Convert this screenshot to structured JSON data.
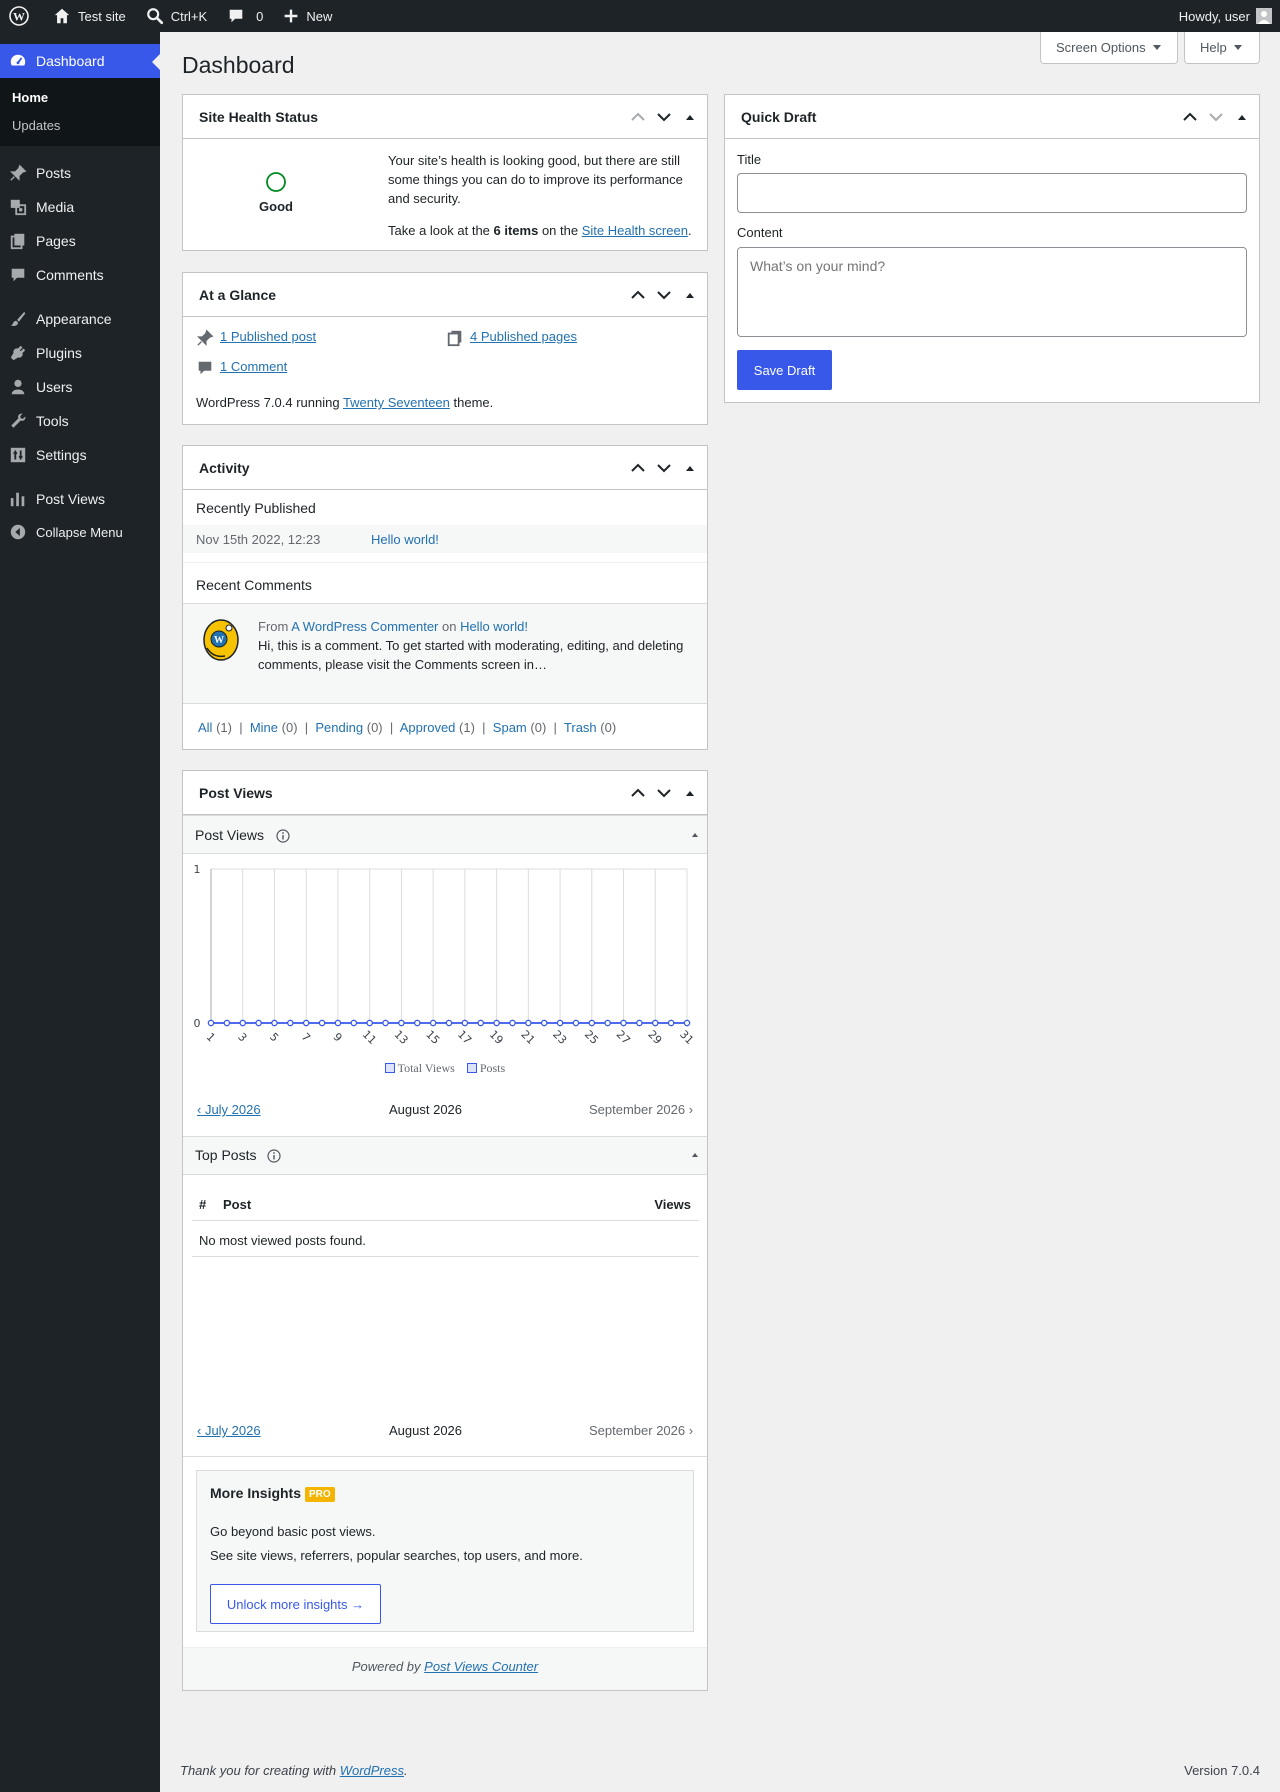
{
  "adminbar": {
    "site_name": "Test site",
    "search_shortcut": "Ctrl+K",
    "comments_count": "0",
    "new_label": "New",
    "howdy": "Howdy, user"
  },
  "sidebar": {
    "dashboard": "Dashboard",
    "submenu": {
      "home": "Home",
      "updates": "Updates"
    },
    "items": [
      {
        "label": "Posts",
        "icon": "pin-icon"
      },
      {
        "label": "Media",
        "icon": "media-icon"
      },
      {
        "label": "Pages",
        "icon": "pages-icon"
      },
      {
        "label": "Comments",
        "icon": "comment-icon"
      },
      {
        "label": "Appearance",
        "icon": "brush-icon"
      },
      {
        "label": "Plugins",
        "icon": "plugin-icon"
      },
      {
        "label": "Users",
        "icon": "user-icon"
      },
      {
        "label": "Tools",
        "icon": "wrench-icon"
      },
      {
        "label": "Settings",
        "icon": "settings-icon"
      },
      {
        "label": "Post Views",
        "icon": "chart-icon"
      }
    ],
    "collapse": "Collapse Menu"
  },
  "header": {
    "title": "Dashboard",
    "screen_options": "Screen Options",
    "help": "Help"
  },
  "site_health": {
    "title": "Site Health Status",
    "status": "Good",
    "message": "Your site’s health is looking good, but there are still some things you can do to improve its performance and security.",
    "take_look_pre": "Take a look at the ",
    "items": "6 items",
    "take_look_mid": " on the ",
    "link": "Site Health screen",
    "take_look_post": "."
  },
  "glance": {
    "title": "At a Glance",
    "posts": "1 Published post",
    "pages": "4 Published pages",
    "comments": "1 Comment",
    "wp_pre": "WordPress 7.0.4 running ",
    "theme": "Twenty Seventeen",
    "wp_post": " theme."
  },
  "activity": {
    "title": "Activity",
    "recent_published": "Recently Published",
    "pub_date": "Nov 15th 2022, 12:23",
    "pub_title": "Hello world!",
    "recent_comments": "Recent Comments",
    "from": "From ",
    "commenter": "A WordPress Commenter",
    "on": " on ",
    "comment_post": "Hello world!",
    "comment_text": "Hi, this is a comment. To get started with moderating, editing, and deleting comments, please visit the Comments screen in…",
    "filters": [
      {
        "label": "All",
        "count": "(1)"
      },
      {
        "label": "Mine",
        "count": "(0)"
      },
      {
        "label": "Pending",
        "count": "(0)"
      },
      {
        "label": "Approved",
        "count": "(1)"
      },
      {
        "label": "Spam",
        "count": "(0)"
      },
      {
        "label": "Trash",
        "count": "(0)"
      }
    ]
  },
  "quick_draft": {
    "title": "Quick Draft",
    "title_label": "Title",
    "title_value": "",
    "content_label": "Content",
    "content_placeholder": "What’s on your mind?",
    "save": "Save Draft"
  },
  "post_views": {
    "title": "Post Views",
    "chart_title": "Post Views",
    "prev": "‹ July 2026",
    "current": "August 2026",
    "next": "September 2026 ›",
    "top_title": "Top Posts",
    "col_num": "#",
    "col_post": "Post",
    "col_views": "Views",
    "empty": "No most viewed posts found.",
    "more_title": "More Insights",
    "pro": "PRO",
    "more_line1": "Go beyond basic post views.",
    "more_line2": "See site views, referrers, popular searches, top users, and more.",
    "unlock": "Unlock more insights →",
    "powered_pre": "Powered by ",
    "powered_link": "Post Views Counter"
  },
  "chart_data": {
    "type": "line",
    "x": [
      1,
      2,
      3,
      4,
      5,
      6,
      7,
      8,
      9,
      10,
      11,
      12,
      13,
      14,
      15,
      16,
      17,
      18,
      19,
      20,
      21,
      22,
      23,
      24,
      25,
      26,
      27,
      28,
      29,
      30,
      31
    ],
    "x_tick_labels": [
      "1",
      "3",
      "5",
      "7",
      "9",
      "11",
      "13",
      "15",
      "17",
      "19",
      "21",
      "23",
      "25",
      "27",
      "29",
      "31"
    ],
    "series": [
      {
        "name": "Total Views",
        "values": [
          0,
          0,
          0,
          0,
          0,
          0,
          0,
          0,
          0,
          0,
          0,
          0,
          0,
          0,
          0,
          0,
          0,
          0,
          0,
          0,
          0,
          0,
          0,
          0,
          0,
          0,
          0,
          0,
          0,
          0,
          0
        ]
      },
      {
        "name": "Posts",
        "values": [
          0,
          0,
          0,
          0,
          0,
          0,
          0,
          0,
          0,
          0,
          0,
          0,
          0,
          0,
          0,
          0,
          0,
          0,
          0,
          0,
          0,
          0,
          0,
          0,
          0,
          0,
          0,
          0,
          0,
          0,
          0
        ]
      }
    ],
    "y_tick_labels": [
      "0",
      "1"
    ],
    "ylim": [
      0,
      1
    ],
    "grid": true,
    "legend": "bottom",
    "colors": {
      "line": "#3858e9",
      "grid": "#dcdcde"
    }
  },
  "footer": {
    "thanks_pre": "Thank you for creating with ",
    "wp_link": "WordPress",
    "thanks_post": ".",
    "version": "Version 7.0.4"
  }
}
